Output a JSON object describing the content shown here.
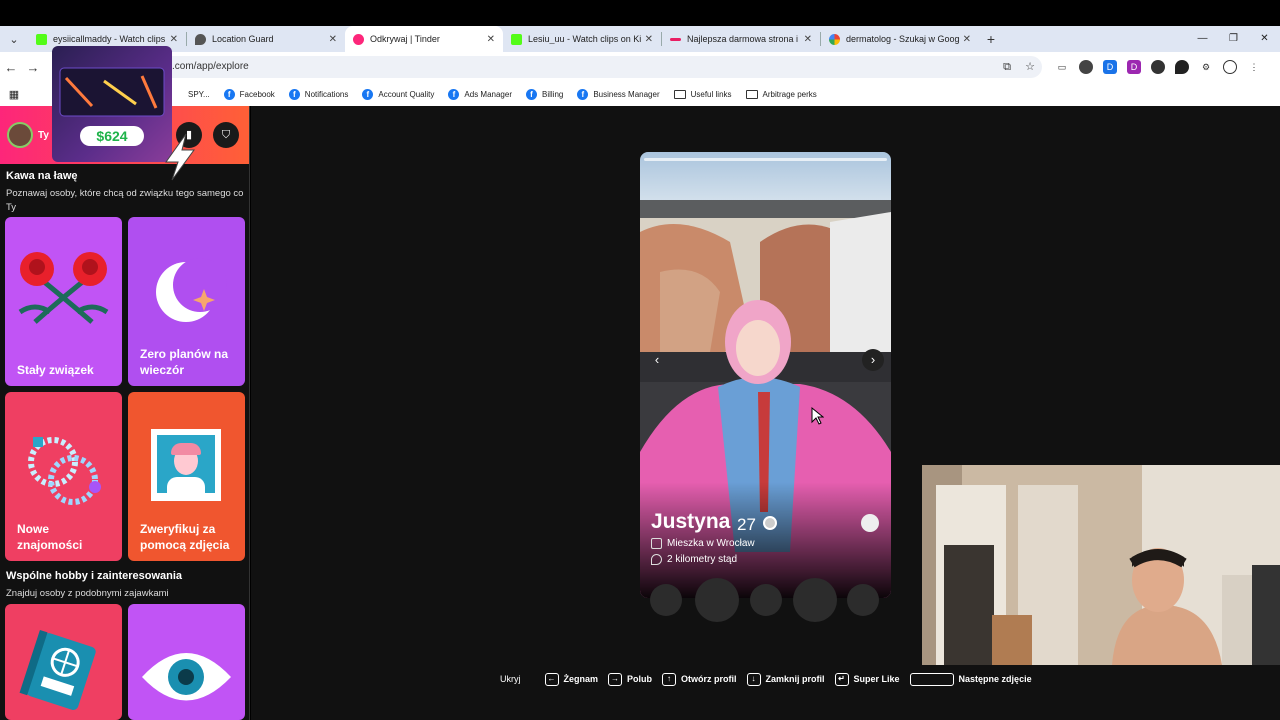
{
  "tabs": [
    {
      "title": "eysiicallmaddy - Watch clips",
      "icon": "kick-icon",
      "color": "#53fc18",
      "active": false
    },
    {
      "title": "Location Guard",
      "icon": "location-icon",
      "color": "#555555",
      "active": false
    },
    {
      "title": "Odkrywaj | Tinder",
      "icon": "tinder-icon",
      "color": "#fd267a",
      "active": true
    },
    {
      "title": "Lesiu_uu - Watch clips on Kick",
      "icon": "kick-icon",
      "color": "#53fc18",
      "active": false
    },
    {
      "title": "Najlepsza darmowa strona i ap",
      "icon": "page-icon",
      "color": "#e91e63",
      "active": false
    },
    {
      "title": "dermatolog - Szukaj w Google",
      "icon": "google-icon",
      "color": "#4285f4",
      "active": false
    }
  ],
  "address": {
    "url": ".com/app/explore"
  },
  "bookmarks": [
    {
      "label": "SPY...",
      "type": "partial"
    },
    {
      "label": "Facebook",
      "type": "facebook"
    },
    {
      "label": "Notifications",
      "type": "facebook"
    },
    {
      "label": "Account Quality",
      "type": "facebook"
    },
    {
      "label": "Ads Manager",
      "type": "facebook"
    },
    {
      "label": "Billing",
      "type": "facebook"
    },
    {
      "label": "Business Manager",
      "type": "facebook"
    },
    {
      "label": "Useful links",
      "type": "folder"
    },
    {
      "label": "Arbitrage perks",
      "type": "folder"
    }
  ],
  "sidebar": {
    "user_label": "Ty",
    "section1": {
      "title": "Kawa na ławę",
      "subtitle": "Poznawaj osoby, które chcą od związku tego samego co Ty"
    },
    "cards1": [
      {
        "label": "Stały związek",
        "color": "#c154f5"
      },
      {
        "label": "Zero planów na wieczór",
        "color": "#b04ff0"
      },
      {
        "label": "Nowe znajomości",
        "color": "#ef3f62"
      },
      {
        "label": "Zweryfikuj za pomocą zdjęcia",
        "color": "#f0562f"
      }
    ],
    "section2": {
      "title": "Wspólne hobby i zainteresowania",
      "subtitle": "Znajduj osoby z podobnymi zajawkami"
    },
    "cards2": [
      {
        "label": "",
        "color": "#ef3f62"
      },
      {
        "label": "",
        "color": "#c154f5"
      }
    ]
  },
  "profile": {
    "name": "Justyna",
    "age": "27",
    "location": "Mieszka w Wrocław",
    "distance": "2 kilometry stąd"
  },
  "shortcuts": [
    {
      "label": "Ukryj",
      "key": ""
    },
    {
      "label": "Żegnam",
      "key": "←"
    },
    {
      "label": "Polub",
      "key": "→"
    },
    {
      "label": "Otwórz profil",
      "key": "↑"
    },
    {
      "label": "Zamknij profil",
      "key": "↓"
    },
    {
      "label": "Super Like",
      "key": "↵"
    },
    {
      "label": "Następne zdjęcie",
      "key": "space"
    }
  ],
  "overlay_ad": {
    "amount": "$624"
  }
}
